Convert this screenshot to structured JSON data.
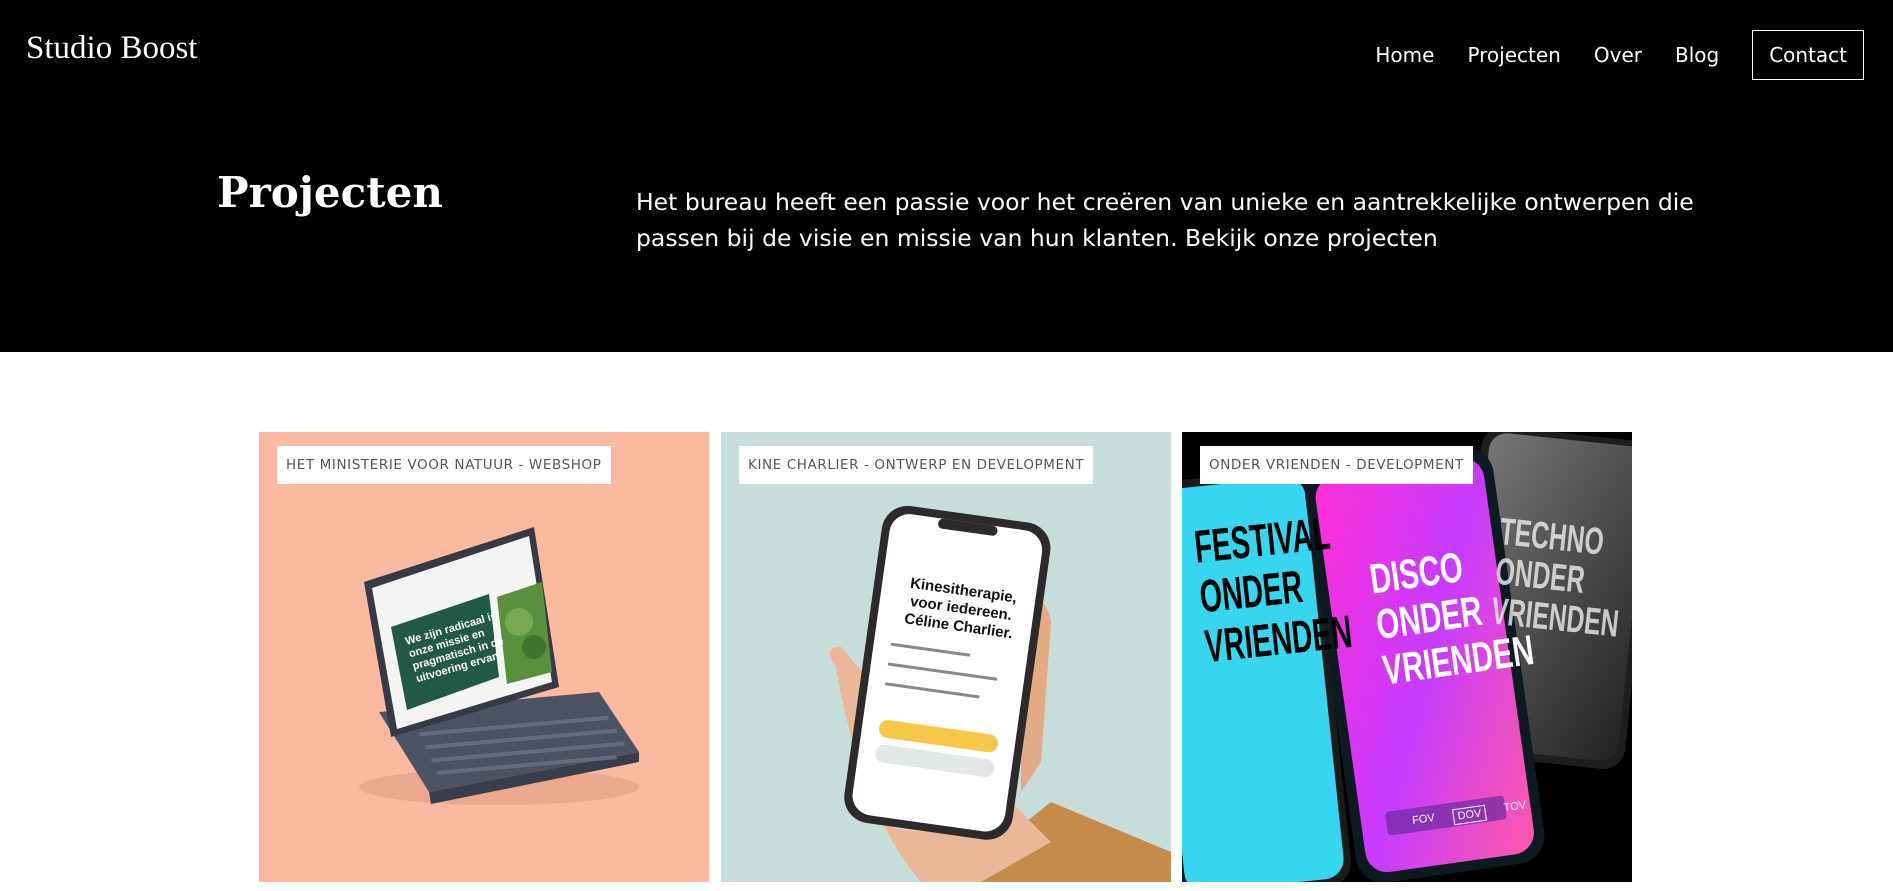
{
  "header": {
    "logo": "Studio Boost",
    "nav": [
      {
        "label": "Home"
      },
      {
        "label": "Projecten"
      },
      {
        "label": "Over"
      },
      {
        "label": "Blog"
      },
      {
        "label": "Contact"
      }
    ]
  },
  "hero": {
    "title": "Projecten",
    "text": "Het bureau heeft een passie voor het creëren van unieke en aantrekkelijke ontwerpen die passen bij de visie en missie van hun klanten. Bekijk onze projecten"
  },
  "projects": [
    {
      "tag": "HET MINISTERIE VOOR NATUUR - WEBSHOP",
      "bg": "#fbb9a0",
      "mockup_heading": "We zijn radicaal in onze missie en pragmatisch in de uitvoering ervan"
    },
    {
      "tag": "KINE CHARLIER - ONTWERP EN DEVELOPMENT",
      "bg": "#c8dcda",
      "mockup_heading": "Kinesitherapie, voor iedereen. Céline Charlier."
    },
    {
      "tag": "ONDER VRIENDEN - DEVELOPMENT",
      "bg": "#000000",
      "mockup_screens": [
        {
          "text": "FESTIVAL ONDER VRIENDEN"
        },
        {
          "text": "DISCO ONDER VRIENDEN"
        },
        {
          "text": "TECHNO ONDER VRIENDEN"
        }
      ],
      "mockup_tabs": [
        "FOV",
        "DOV",
        "TOV"
      ]
    }
  ]
}
